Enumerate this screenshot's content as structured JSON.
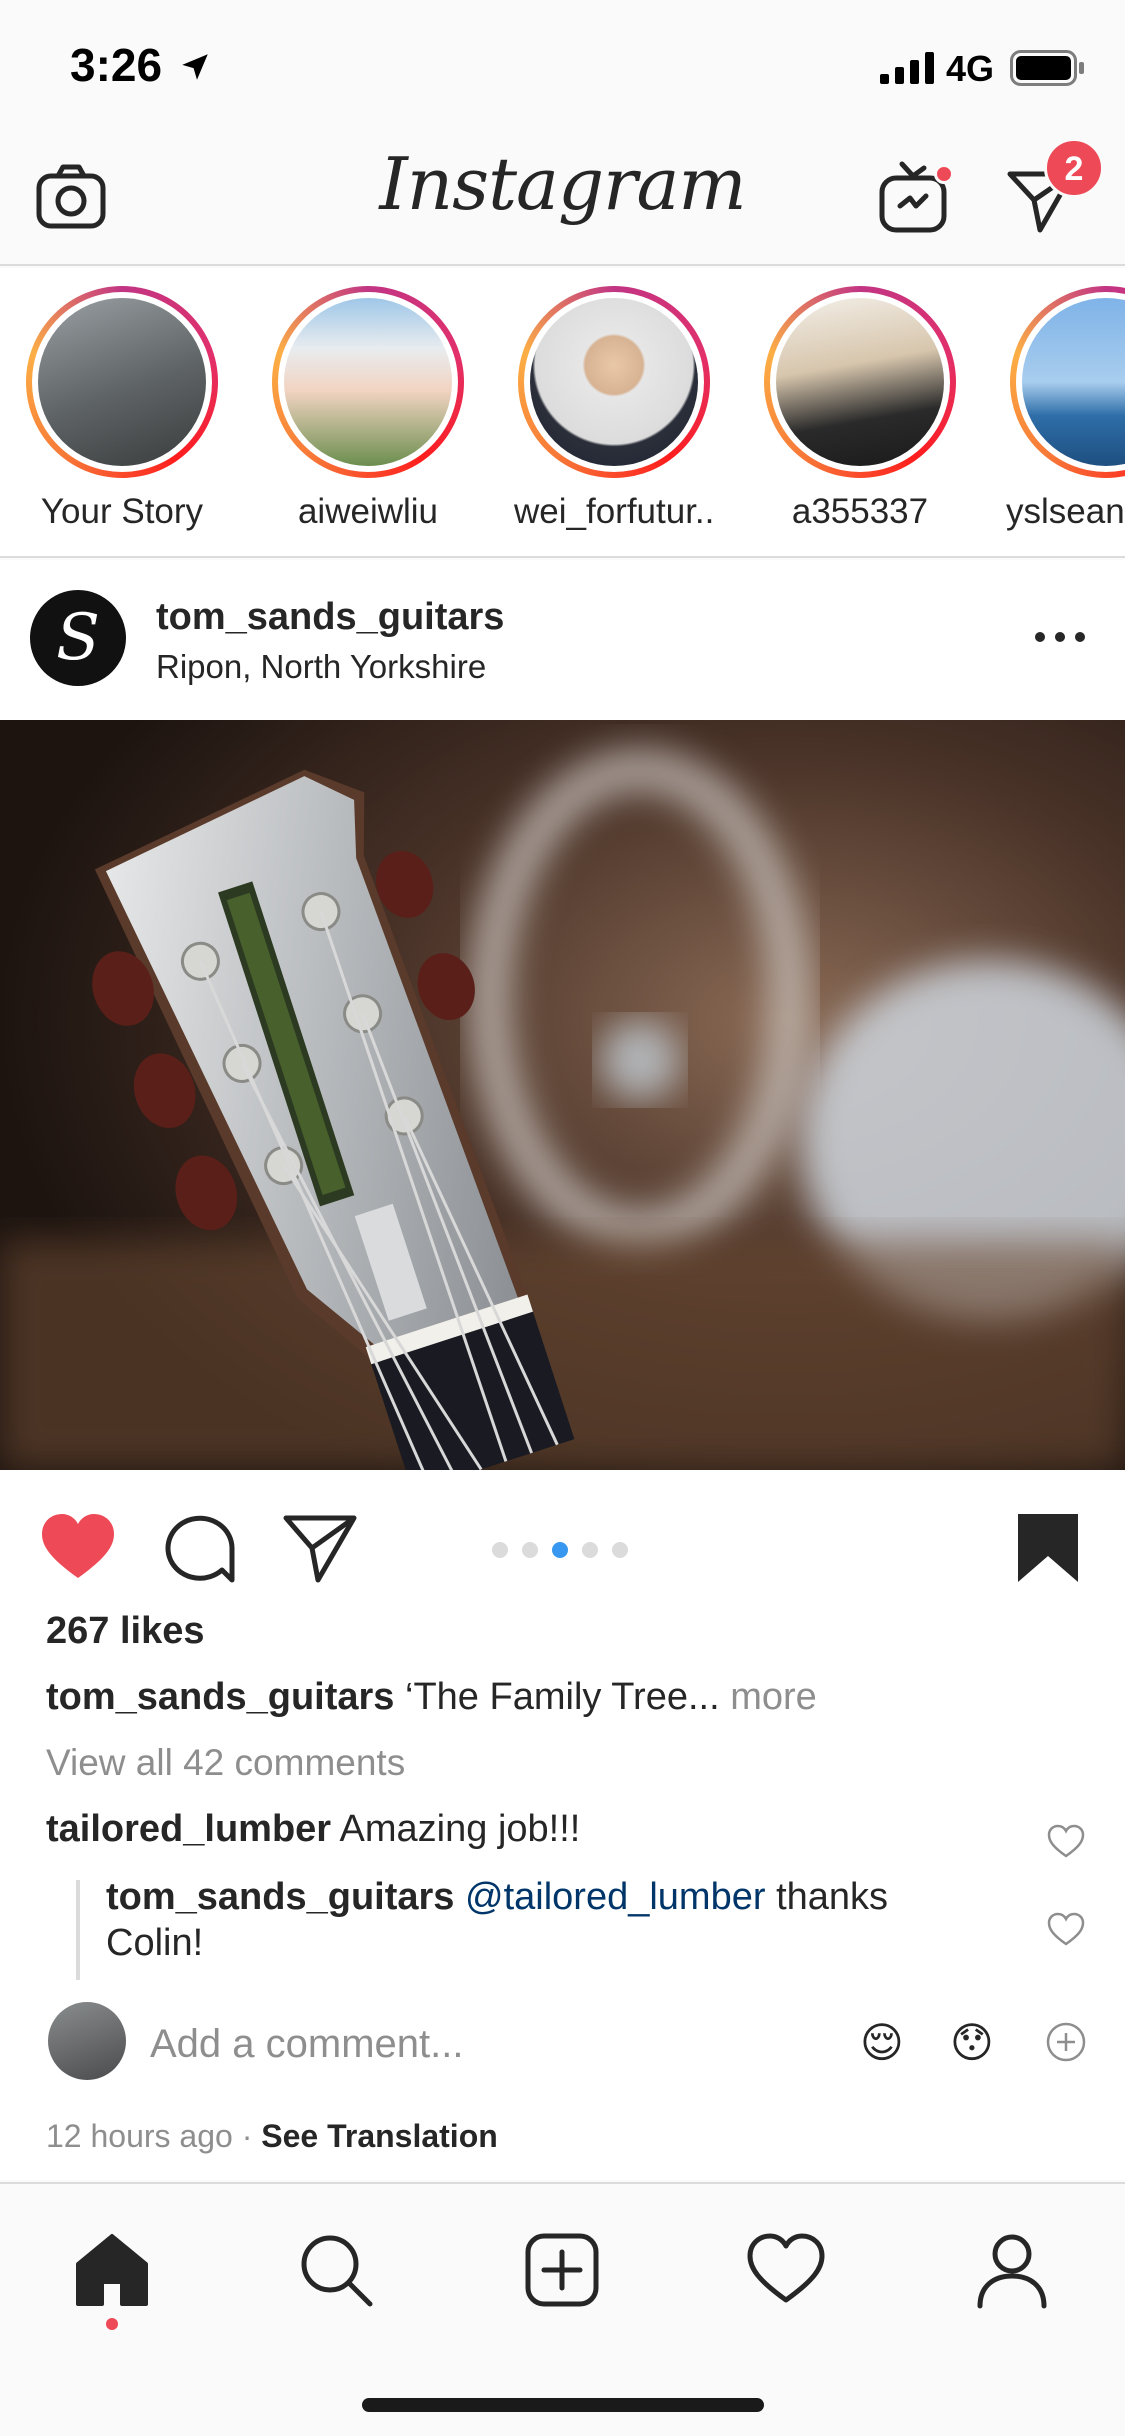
{
  "status_bar": {
    "time": "3:26",
    "network": "4G"
  },
  "header": {
    "logo": "Instagram",
    "direct_badge_count": "2"
  },
  "stories": [
    {
      "label": "Your Story"
    },
    {
      "label": "aiweiwliu"
    },
    {
      "label": "wei_forfutur..."
    },
    {
      "label": "a355337"
    },
    {
      "label": "yslsean"
    }
  ],
  "post": {
    "username": "tom_sands_guitars",
    "location": "Ripon, North Yorkshire",
    "avatar_letter": "S",
    "carousel": {
      "count": 5,
      "active_index": 2
    },
    "liked": true,
    "saved": true,
    "likes": "267 likes",
    "caption": {
      "username": "tom_sands_guitars",
      "text": "‘The Family Tree...",
      "more": "more"
    },
    "view_all_comments": "View all 42 comments",
    "comments": [
      {
        "username": "tailored_lumber",
        "text": "Amazing job!!!"
      },
      {
        "username": "tom_sands_guitars",
        "mention": "@tailored_lumber",
        "text": "thanks Colin!"
      }
    ],
    "add_comment_placeholder": "Add a comment...",
    "quick_emojis": [
      "😌",
      "😯"
    ],
    "time_ago": "12 hours ago",
    "separator": "·",
    "see_translation": "See Translation"
  },
  "colors": {
    "like_red": "#ed4956",
    "link_blue": "#003569",
    "carousel_active": "#3897f0"
  }
}
